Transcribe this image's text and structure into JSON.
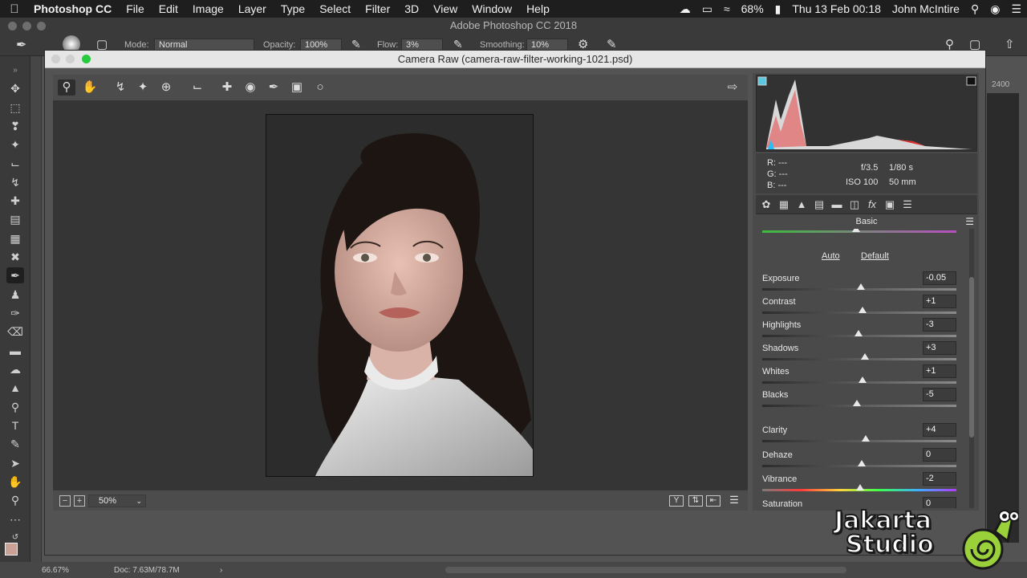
{
  "menubar": {
    "items": [
      "Photoshop CC",
      "File",
      "Edit",
      "Image",
      "Layer",
      "Type",
      "Select",
      "Filter",
      "3D",
      "View",
      "Window",
      "Help"
    ],
    "battery": "68%",
    "datetime": "Thu 13 Feb  00:18",
    "user": "John McIntire"
  },
  "ps": {
    "window_title": "Adobe Photoshop CC 2018",
    "options": {
      "mode_label": "Mode:",
      "mode_value": "Normal",
      "opacity_label": "Opacity:",
      "opacity_value": "100%",
      "flow_label": "Flow:",
      "flow_value": "3%",
      "smoothing_label": "Smoothing:",
      "smoothing_value": "10%"
    },
    "status": {
      "zoom": "66.67%",
      "doc": "Doc: 7.63M/78.7M",
      "arrow": "›",
      "ruler_value": "2400"
    }
  },
  "camera_raw": {
    "title": "Camera Raw (camera-raw-filter-working-1021.psd)",
    "zoom": "50%",
    "readout": {
      "r": "R:   ---",
      "g": "G:   ---",
      "b": "B:   ---",
      "aperture": "f/3.5",
      "shutter": "1/80 s",
      "iso": "ISO 100",
      "focal": "50 mm"
    },
    "panel_title": "Basic",
    "auto_label": "Auto",
    "default_label": "Default",
    "sliders": [
      {
        "label": "Exposure",
        "value": "-0.05"
      },
      {
        "label": "Contrast",
        "value": "+1"
      },
      {
        "label": "Highlights",
        "value": "-3"
      },
      {
        "label": "Shadows",
        "value": "+3"
      },
      {
        "label": "Whites",
        "value": "+1"
      },
      {
        "label": "Blacks",
        "value": "-5"
      },
      {
        "label": "Clarity",
        "value": "+4"
      },
      {
        "label": "Dehaze",
        "value": "0"
      },
      {
        "label": "Vibrance",
        "value": "-2"
      },
      {
        "label": "Saturation",
        "value": "0"
      }
    ]
  },
  "watermark": {
    "line1": "Jakarta",
    "line2": "Studio"
  },
  "icons": {
    "ps_tools": [
      "move-icon",
      "marquee-icon",
      "lasso-icon",
      "magic-wand-icon",
      "crop-icon",
      "eyedropper-icon",
      "healing-icon",
      "brush-icon",
      "stamp-icon",
      "history-brush-icon",
      "eraser-icon",
      "gradient-icon",
      "blur-icon",
      "dodge-icon",
      "pen-icon",
      "type-icon",
      "path-select-icon",
      "hand-icon",
      "zoom-icon",
      "more-icon"
    ],
    "cr_tools": [
      "zoom-icon",
      "hand-icon",
      "white-balance-icon",
      "color-sampler-icon",
      "targeted-adjust-icon",
      "crop-icon",
      "spot-removal-icon",
      "red-eye-icon",
      "adjust-brush-icon",
      "graduated-filter-icon",
      "radial-filter-icon"
    ]
  },
  "colors": {
    "panel_bg": "#4a4a4a",
    "preview_bg": "#353535",
    "dialog_title_bg": "#e6e6e6"
  }
}
